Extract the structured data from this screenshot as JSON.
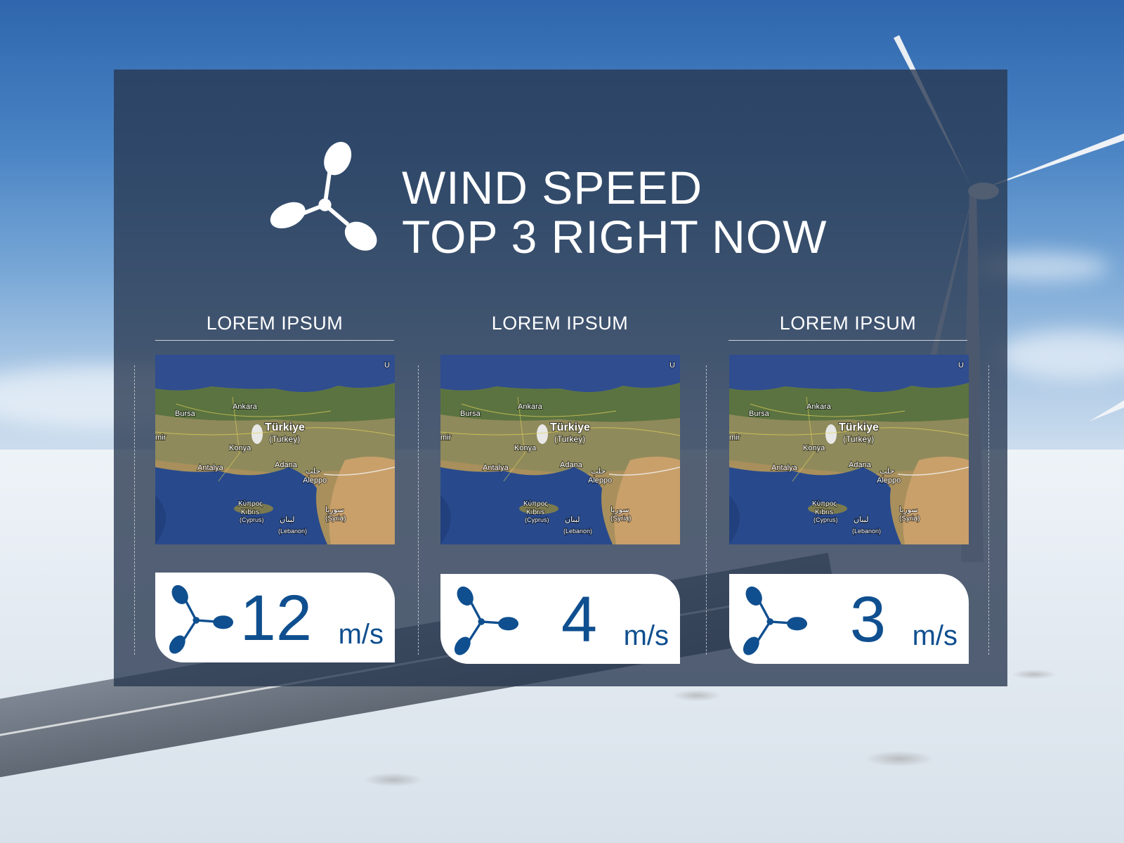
{
  "title": {
    "line1": "WIND SPEED",
    "line2": "TOP 3 RIGHT NOW"
  },
  "colors": {
    "panel": "#283750",
    "accent": "#0f4f8f",
    "card": "#ffffff"
  },
  "icons": {
    "title": "wind-turbine-icon",
    "card": "wind-turbine-icon"
  },
  "map_labels": {
    "country": "Türkiye",
    "country_alt": "(Turkey)",
    "cities": [
      "Bursa",
      "Ankara",
      "Konya",
      "Antalya",
      "Adana",
      "Aleppo",
      "حلب"
    ],
    "cyprus_gr": "Κύπρος",
    "cyprus_tr": "Kıbrıs",
    "cyprus_en": "(Cyprus)",
    "lebanon_ar": "لبنان",
    "lebanon_en": "(Lebanon)",
    "syria_ar": "سوريا",
    "syria_en": "(Syria)",
    "edge_left": "mir",
    "edge_top": "U"
  },
  "locations": [
    {
      "label": "LOREM IPSUM",
      "value": "12",
      "unit": "m/s"
    },
    {
      "label": "LOREM IPSUM",
      "value": "4",
      "unit": "m/s"
    },
    {
      "label": "LOREM IPSUM",
      "value": "3",
      "unit": "m/s"
    }
  ]
}
